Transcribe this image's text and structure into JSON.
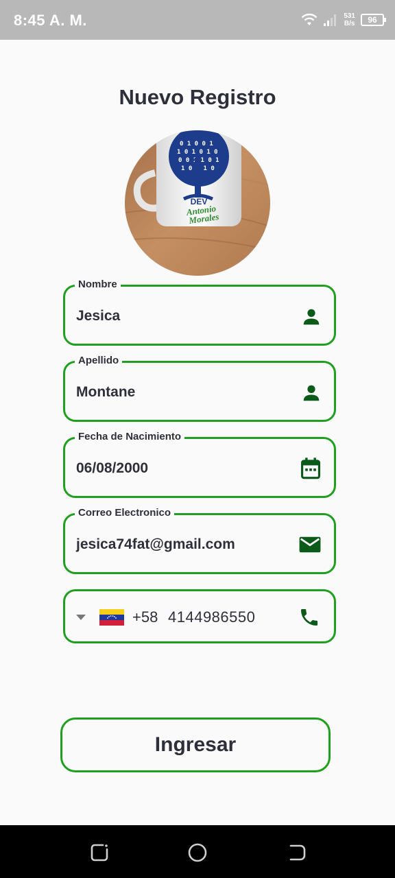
{
  "status_bar": {
    "time": "8:45 A. M.",
    "net_speed_value": "531",
    "net_speed_unit": "B/s",
    "battery_level": "96",
    "icons": [
      "wifi-icon",
      "signal-icon",
      "battery-icon"
    ]
  },
  "header": {
    "title": "Nuevo Registro"
  },
  "avatar": {
    "logo_text": [
      "DEV",
      "Antonio",
      "Morales"
    ]
  },
  "form": {
    "nombre": {
      "label": "Nombre",
      "value": "Jesica",
      "icon": "person-icon"
    },
    "apellido": {
      "label": "Apellido",
      "value": "Montane",
      "icon": "person-icon"
    },
    "fecha_nacimiento": {
      "label": "Fecha de Nacimiento",
      "value": "06/08/2000",
      "icon": "calendar-icon"
    },
    "correo": {
      "label": "Correo Electronico",
      "value": "jesica74fat@gmail.com",
      "icon": "mail-icon"
    },
    "telefono": {
      "country_flag": "venezuela-flag",
      "dial_code": "+58",
      "number": "4144986550",
      "icon": "phone-icon"
    }
  },
  "actions": {
    "submit_label": "Ingresar"
  },
  "nav_bar": {
    "buttons": [
      "recent-apps-icon",
      "home-icon",
      "back-icon"
    ]
  },
  "colors": {
    "accent_green": "#1ea01e",
    "icon_green": "#0b5a1a",
    "text": "#2f2f3c",
    "status_bar": "#b8b8b8",
    "background": "#fafafa"
  }
}
